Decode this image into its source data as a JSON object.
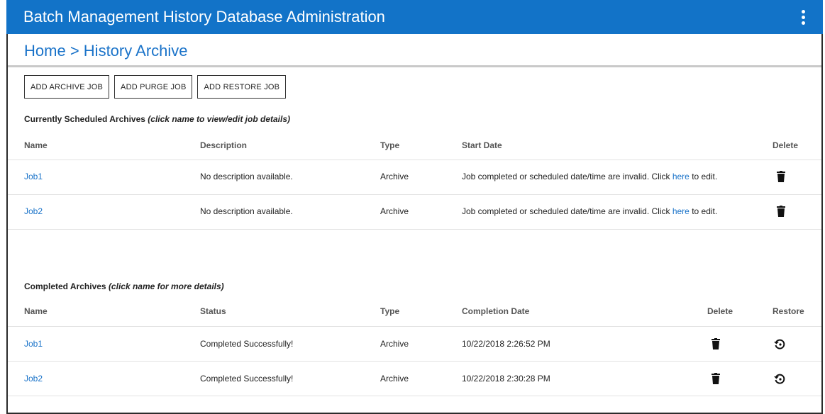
{
  "app": {
    "title": "Batch Management History Database Administration"
  },
  "breadcrumb": {
    "home": "Home",
    "separator": ">",
    "current": "History Archive"
  },
  "toolbar": {
    "add_archive": "ADD ARCHIVE JOB",
    "add_purge": "ADD PURGE JOB",
    "add_restore": "ADD RESTORE JOB"
  },
  "scheduled": {
    "title": "Currently Scheduled Archives",
    "hint": "(click name to view/edit job details)",
    "columns": {
      "name": "Name",
      "description": "Description",
      "type": "Type",
      "start": "Start Date",
      "delete": "Delete"
    },
    "rows": [
      {
        "name": "Job1",
        "description": "No description available.",
        "type": "Archive",
        "start_prefix": "Job completed or scheduled date/time are invalid. Click ",
        "start_link": "here",
        "start_suffix": " to edit."
      },
      {
        "name": "Job2",
        "description": "No description available.",
        "type": "Archive",
        "start_prefix": "Job completed or scheduled date/time are invalid. Click ",
        "start_link": "here",
        "start_suffix": " to edit."
      }
    ]
  },
  "completed": {
    "title": "Completed Archives",
    "hint": "(click name for more details)",
    "columns": {
      "name": "Name",
      "status": "Status",
      "type": "Type",
      "date": "Completion Date",
      "delete": "Delete",
      "restore": "Restore"
    },
    "rows": [
      {
        "name": "Job1",
        "status": "Completed Successfully!",
        "type": "Archive",
        "date": "10/22/2018 2:26:52 PM"
      },
      {
        "name": "Job2",
        "status": "Completed Successfully!",
        "type": "Archive",
        "date": "10/22/2018 2:30:28 PM"
      }
    ]
  },
  "icons": {
    "menu": "kebab-menu-icon",
    "delete": "trash-icon",
    "restore": "restore-icon"
  },
  "colors": {
    "header_bg": "#1273c8",
    "link": "#1a73c9"
  }
}
